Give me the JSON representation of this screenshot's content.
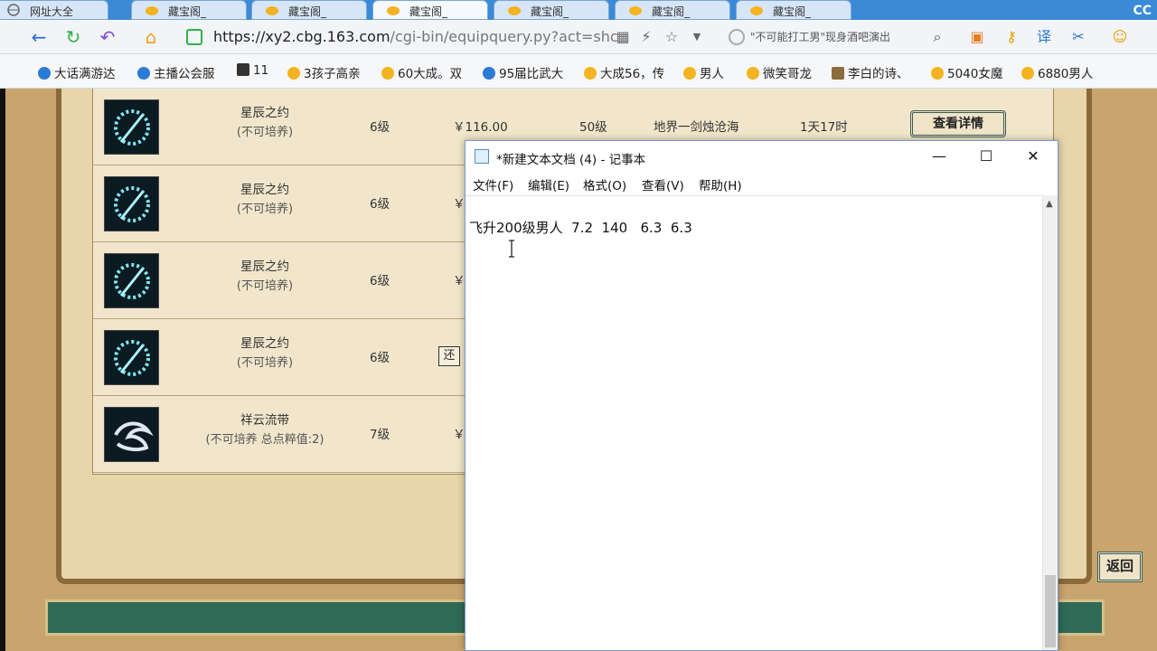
{
  "tabs": [
    {
      "label": "网址大全"
    },
    {
      "label": "藏宝阁_"
    },
    {
      "label": "藏宝阁_"
    },
    {
      "label": "藏宝阁_"
    },
    {
      "label": "藏宝阁_"
    },
    {
      "label": "藏宝阁_"
    },
    {
      "label": "藏宝阁_"
    }
  ],
  "brand_logo": "CC",
  "address": {
    "url_main": "https://xy2.cbg.163.com",
    "url_rest": "/cgi-bin/equipquery.py?act=shc",
    "search_text": "\"不可能打工男\"现身酒吧演出"
  },
  "bookmarks": [
    {
      "label": "大话满游达"
    },
    {
      "label": "主播公会服"
    },
    {
      "label": "11"
    },
    {
      "label": "3孩子高亲"
    },
    {
      "label": "60大成。双"
    },
    {
      "label": "95届比武大"
    },
    {
      "label": "大成56，传"
    },
    {
      "label": "男人"
    },
    {
      "label": "微笑哥龙"
    },
    {
      "label": "李白的诗、"
    },
    {
      "label": "5040女魔"
    },
    {
      "label": "6880男人"
    }
  ],
  "rows": [
    {
      "name": "星辰之约",
      "sub": "(不可培养)",
      "level": "6级",
      "price": "￥116.00",
      "glv": "50级",
      "server": "地界一剑烛沧海",
      "time": "1天17时"
    },
    {
      "name": "星辰之约",
      "sub": "(不可培养)",
      "level": "6级",
      "price": "￥"
    },
    {
      "name": "星辰之约",
      "sub": "(不可培养)",
      "level": "6级",
      "price": "￥"
    },
    {
      "name": "星辰之约",
      "sub": "(不可培养)",
      "level": "6级",
      "price": "还"
    },
    {
      "name": "祥云流带",
      "sub": "(不可培养 总点粹值:2)",
      "level": "7级",
      "price": "￥"
    }
  ],
  "detail_button": "查看详情",
  "back_button": "返回",
  "notepad": {
    "title": "*新建文本文档 (4) - 记事本",
    "menu": [
      "文件(F)",
      "编辑(E)",
      "格式(O)",
      "查看(V)",
      "帮助(H)"
    ],
    "content": "飞升200级男人  7.2  140   6.3  6.3"
  },
  "colors": {
    "tab_bar": "#3a8ad6",
    "parchment": "#e8d5aa",
    "page_bg": "#c9a56e",
    "teal_strip": "#2f6b57"
  }
}
